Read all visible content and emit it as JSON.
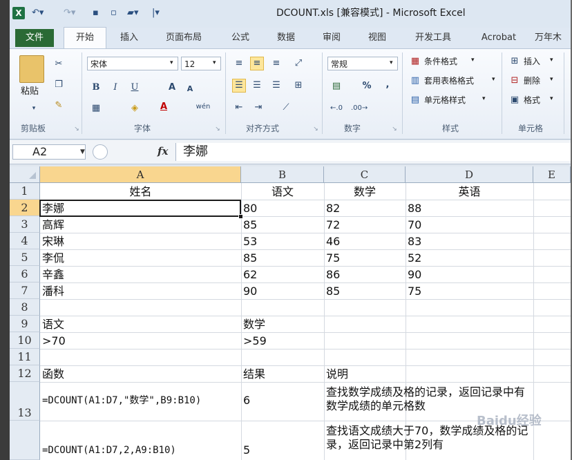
{
  "window": {
    "app_icon": "excel-icon",
    "title": "DCOUNT.xls  [兼容模式] - Microsoft Excel"
  },
  "tabs": [
    "文件",
    "开始",
    "插入",
    "页面布局",
    "公式",
    "数据",
    "审阅",
    "视图",
    "开发工具",
    "Acrobat",
    "万年木"
  ],
  "ribbon": {
    "clipboard": {
      "paste": "粘贴",
      "label": "剪贴板"
    },
    "font": {
      "name": "宋体",
      "size": "12",
      "label": "字体",
      "bold": "B",
      "italic": "I",
      "underline": "U",
      "grow": "A",
      "shrink": "A",
      "color_a": "A",
      "phonetic": "wén"
    },
    "alignment": {
      "label": "对齐方式"
    },
    "number": {
      "format": "常规",
      "percent": "%",
      "comma": ",",
      "label": "数字"
    },
    "styles": {
      "conditional": "条件格式",
      "table": "套用表格格式",
      "cell_styles": "单元格样式",
      "label": "样式"
    },
    "cells": {
      "insert": "插入",
      "delete": "删除",
      "format": "格式",
      "label": "单元格"
    }
  },
  "formula_bar": {
    "name_box": "A2",
    "fx": "fx",
    "content": "李娜"
  },
  "columns": [
    "A",
    "B",
    "C",
    "D",
    "E"
  ],
  "rows": [
    "1",
    "2",
    "3",
    "4",
    "5",
    "6",
    "7",
    "8",
    "9",
    "10",
    "11",
    "12",
    "13"
  ],
  "sheet": {
    "header": [
      "姓名",
      "语文",
      "数学",
      "英语"
    ],
    "data": [
      [
        "李娜",
        "80",
        "82",
        "88"
      ],
      [
        "高辉",
        "85",
        "72",
        "70"
      ],
      [
        "宋琳",
        "53",
        "46",
        "83"
      ],
      [
        "李侃",
        "85",
        "75",
        "52"
      ],
      [
        "辛鑫",
        "62",
        "86",
        "90"
      ],
      [
        "潘科",
        "90",
        "85",
        "75"
      ]
    ],
    "criteria_header": [
      "语文",
      "数学"
    ],
    "criteria": [
      ">70",
      ">59"
    ],
    "func_header": [
      "函数",
      "结果",
      "说明"
    ],
    "func_rows": [
      {
        "formula": "=DCOUNT(A1:D7,\"数学\",B9:B10)",
        "result": "6",
        "note": "查找数学成绩及格的记录，返回记录中有数学成绩的单元格数"
      },
      {
        "formula": "=DCOUNT(A1:D7,2,A9:B10)",
        "result": "5",
        "note": "查找语文成绩大于70，数学成绩及格的记录，返回记录中第2列有"
      }
    ]
  },
  "watermark": "Baidu经验"
}
